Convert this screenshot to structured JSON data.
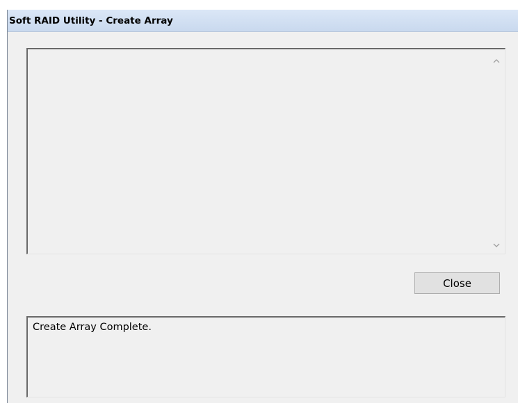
{
  "window": {
    "title": "Soft RAID Utility - Create Array"
  },
  "log": {
    "text": "",
    "scroll_up_icon": "chevron-up-icon",
    "scroll_down_icon": "chevron-down-icon"
  },
  "buttons": {
    "close_label": "Close"
  },
  "status": {
    "message": "Create Array Complete."
  },
  "colors": {
    "title_bar": "#c9d9ee",
    "window_bg": "#f0f0f0",
    "button_bg": "#e1e1e1"
  }
}
